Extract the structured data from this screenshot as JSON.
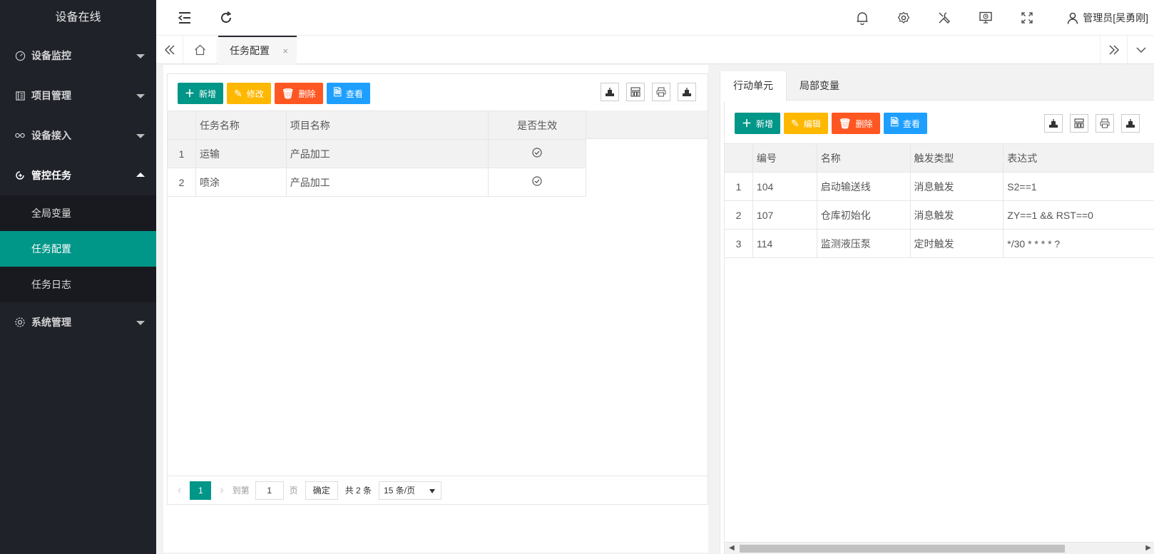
{
  "app": {
    "title": "设备在线"
  },
  "sidebar": {
    "items": [
      {
        "label": "设备监控",
        "icon": "gauge-icon",
        "expanded": false
      },
      {
        "label": "项目管理",
        "icon": "book-icon",
        "expanded": false
      },
      {
        "label": "设备接入",
        "icon": "link-icon",
        "expanded": false
      },
      {
        "label": "管控任务",
        "icon": "sync-icon",
        "expanded": true
      },
      {
        "label": "系统管理",
        "icon": "gear-icon",
        "expanded": false
      }
    ],
    "subitems": [
      {
        "label": "全局变量",
        "active": false
      },
      {
        "label": "任务配置",
        "active": true
      },
      {
        "label": "任务日志",
        "active": false
      }
    ]
  },
  "topbar": {
    "user_label": "管理员[吴勇刚]"
  },
  "tabs": {
    "current": "任务配置",
    "close_glyph": "×"
  },
  "left_panel": {
    "buttons": {
      "add": "新增",
      "edit": "修改",
      "delete": "删除",
      "view": "查看"
    },
    "columns": [
      "任务名称",
      "项目名称",
      "是否生效"
    ],
    "rows": [
      {
        "index": "1",
        "task_name": "运输",
        "project_name": "产品加工",
        "effective": "✓"
      },
      {
        "index": "2",
        "task_name": "喷涂",
        "project_name": "产品加工",
        "effective": "✓"
      }
    ],
    "pager": {
      "current_page": "1",
      "goto_label": "到第",
      "goto_value": "1",
      "page_unit": "页",
      "confirm": "确定",
      "total": "共 2 条",
      "page_size": "15 条/页"
    }
  },
  "right_panel": {
    "tabs": [
      "行动单元",
      "局部变量"
    ],
    "buttons": {
      "add": "新增",
      "edit": "编辑",
      "delete": "删除",
      "view": "查看"
    },
    "columns": [
      "编号",
      "名称",
      "触发类型",
      "表达式"
    ],
    "rows": [
      {
        "index": "1",
        "code": "104",
        "name": "启动输送线",
        "trigger": "消息触发",
        "expression": "S2==1"
      },
      {
        "index": "2",
        "code": "107",
        "name": "仓库初始化",
        "trigger": "消息触发",
        "expression": "ZY==1 && RST==0"
      },
      {
        "index": "3",
        "code": "114",
        "name": "监测液压泵",
        "trigger": "定时触发",
        "expression": "*/30 * * * * ?"
      }
    ]
  },
  "colors": {
    "sidebar_bg": "#20222a",
    "accent": "#009688",
    "orange": "#ffb800",
    "red": "#ff5722",
    "blue": "#1e9fff"
  }
}
